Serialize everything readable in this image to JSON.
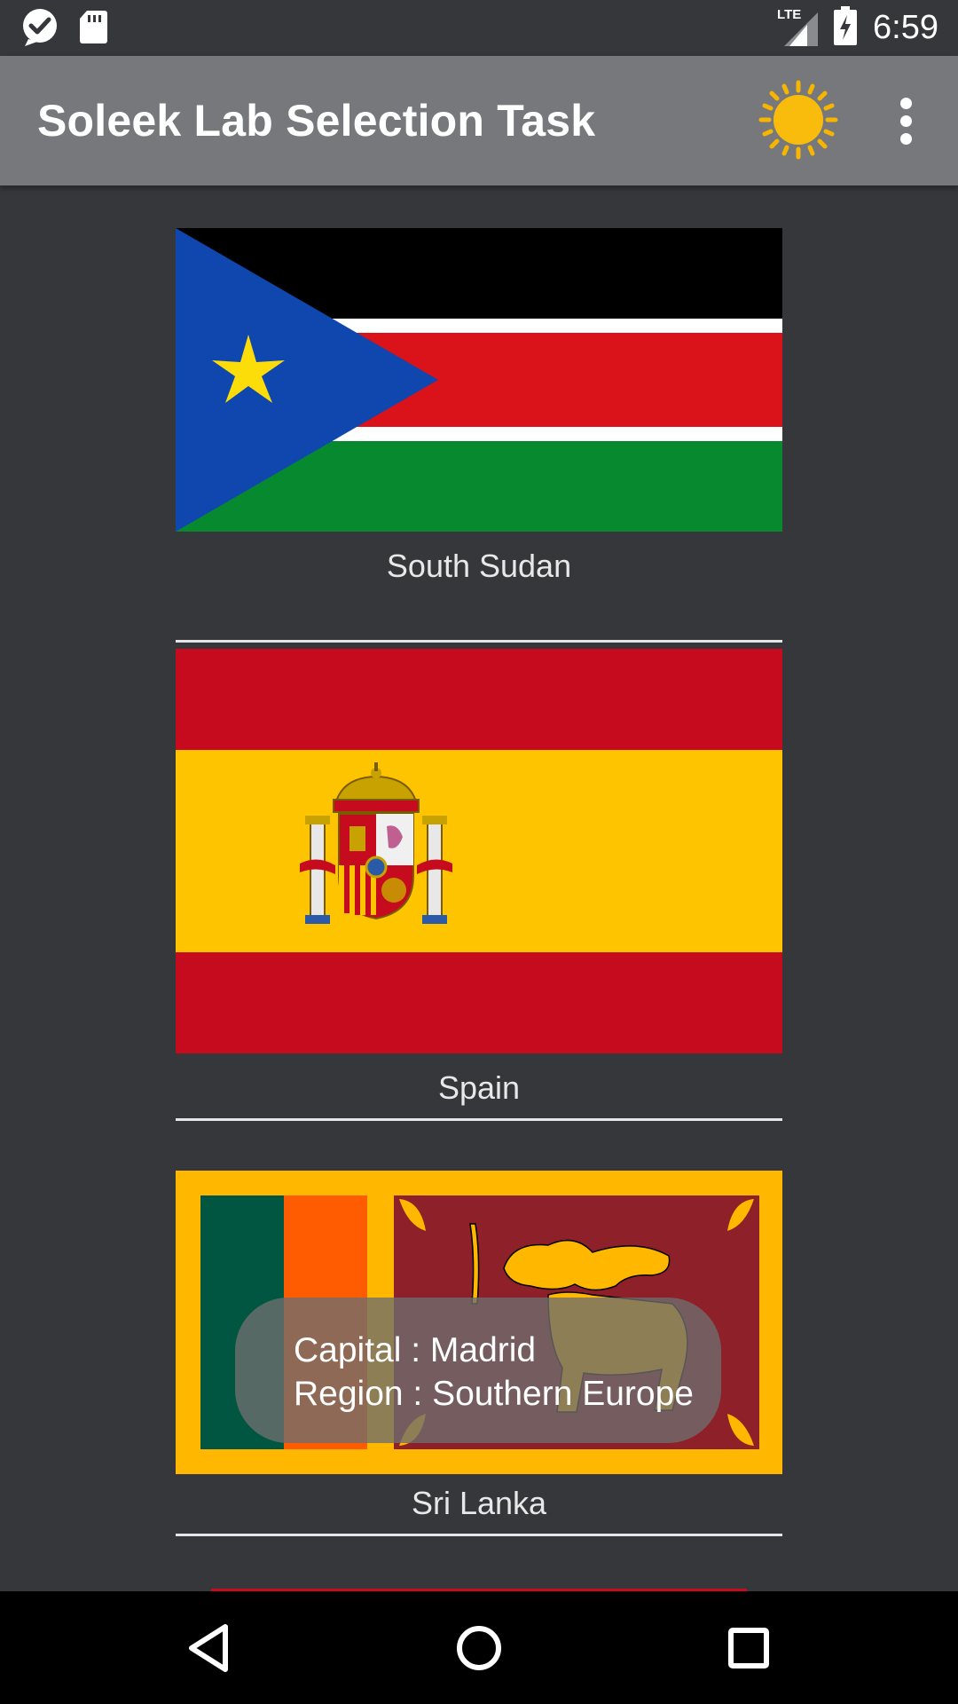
{
  "status_bar": {
    "time": "6:59",
    "network": "LTE",
    "icons": [
      "check-notification-icon",
      "sd-card-icon",
      "lte-signal-icon",
      "battery-charging-icon"
    ]
  },
  "app_bar": {
    "title": "Soleek Lab Selection Task",
    "actions": [
      "sun-icon",
      "overflow-menu-icon"
    ]
  },
  "countries": [
    {
      "name": "South Sudan",
      "flag": "south-sudan-flag"
    },
    {
      "name": "Spain",
      "flag": "spain-flag"
    },
    {
      "name": "Sri Lanka",
      "flag": "sri-lanka-flag"
    }
  ],
  "toast": {
    "capital": "Capital : Madrid",
    "region": "Region : Southern Europe"
  },
  "nav_bar": {
    "buttons": [
      "back-icon",
      "home-icon",
      "recents-icon"
    ]
  },
  "colors": {
    "background": "#35373b",
    "app_bar": "#77787c",
    "sun": "#f7b500"
  }
}
